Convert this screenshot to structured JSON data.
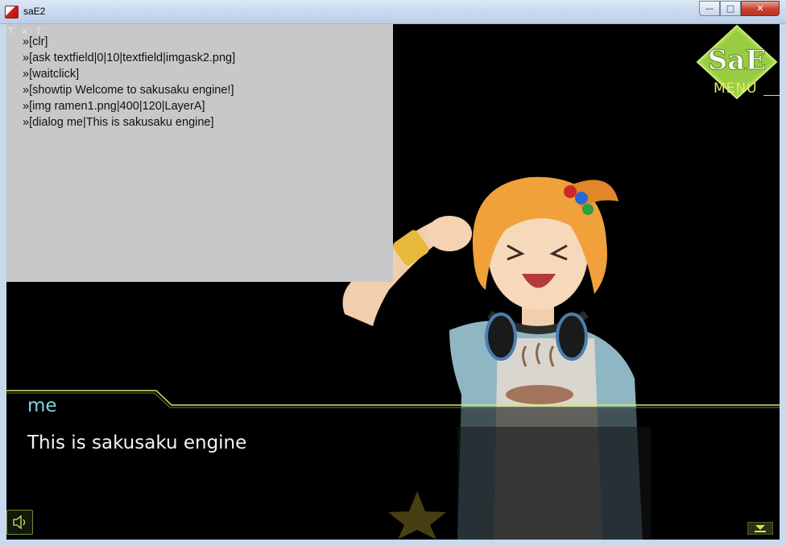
{
  "window": {
    "title": "saE2",
    "minimize_glyph": "—",
    "maximize_glyph": "□",
    "close_glyph": "✕"
  },
  "log": {
    "corner_label": "T x T",
    "lines": [
      "»[clr]",
      "»[ask  textfield|0|10|textfield|imgask2.png]",
      "»[waitclick]",
      "»[showtip Welcome to sakusaku engine!]",
      "»[img ramen1.png|400|120|LayerA]",
      "»[dialog me|This is sakusaku engine]"
    ]
  },
  "menu": {
    "logo_text": "SaE",
    "label": "MENU"
  },
  "dialog": {
    "speaker": "me",
    "text": "This is sakusaku engine"
  },
  "icons": {
    "sound": "speaker-icon",
    "next": "next-page-icon"
  },
  "colors": {
    "accent_green": "#a6d64a",
    "speaker_name": "#7fd6e0",
    "log_bg": "#c8c8c8"
  }
}
